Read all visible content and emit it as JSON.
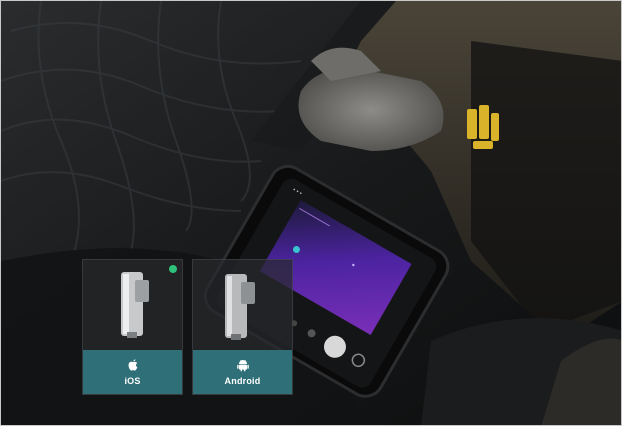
{
  "options": [
    {
      "id": "ios",
      "label": "iOS",
      "icon": "apple-icon",
      "selected": true
    },
    {
      "id": "android",
      "label": "Android",
      "icon": "android-icon",
      "selected": false
    }
  ],
  "colors": {
    "label_bar": "#2e6f78",
    "selected_indicator": "#2fc27a",
    "screen_accent": "#6d2fb3"
  }
}
